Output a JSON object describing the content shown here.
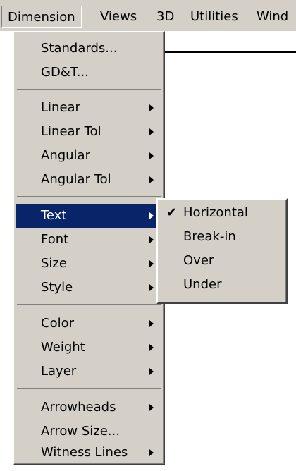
{
  "menubar": {
    "items": [
      "Dimension",
      "Views",
      "3D",
      "Utilities",
      "Wind"
    ]
  },
  "dimension_menu": {
    "items": [
      {
        "label": "Standards...",
        "submenu": false
      },
      {
        "label": "GD&T...",
        "submenu": false
      },
      {
        "label": "Linear",
        "submenu": true
      },
      {
        "label": "Linear Tol",
        "submenu": true
      },
      {
        "label": "Angular",
        "submenu": true
      },
      {
        "label": "Angular Tol",
        "submenu": true
      },
      {
        "label": "Text",
        "submenu": true,
        "active": true
      },
      {
        "label": "Font",
        "submenu": true
      },
      {
        "label": "Size",
        "submenu": true
      },
      {
        "label": "Style",
        "submenu": true
      },
      {
        "label": "Color",
        "submenu": true
      },
      {
        "label": "Weight",
        "submenu": true
      },
      {
        "label": "Layer",
        "submenu": true
      },
      {
        "label": "Arrowheads",
        "submenu": true
      },
      {
        "label": "Arrow Size...",
        "submenu": false
      },
      {
        "label": "Witness Lines",
        "submenu": true
      }
    ]
  },
  "text_submenu": {
    "items": [
      {
        "label": "Horizontal",
        "checked": true
      },
      {
        "label": "Break-in",
        "checked": false
      },
      {
        "label": "Over",
        "checked": false
      },
      {
        "label": "Under",
        "checked": false
      }
    ],
    "check_glyph": "✔"
  },
  "colors": {
    "menu_bg": "#d4d0c8",
    "highlight": "#0a246a",
    "highlight_text": "#ffffff"
  }
}
